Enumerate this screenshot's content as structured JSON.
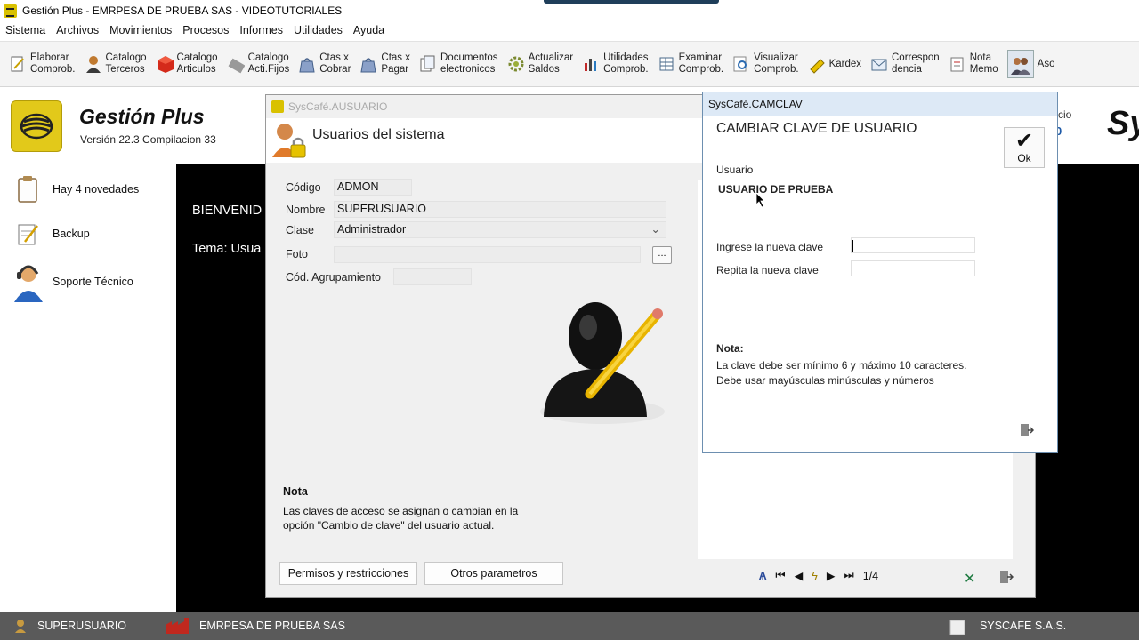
{
  "window": {
    "title": "Gestión Plus - EMRPESA DE PRUEBA SAS - VIDEOTUTORIALES"
  },
  "menu": [
    "Sistema",
    "Archivos",
    "Movimientos",
    "Procesos",
    "Informes",
    "Utilidades",
    "Ayuda"
  ],
  "toolbar": [
    {
      "l1": "Elaborar",
      "l2": "Comprob.",
      "icon": "pencil-doc-icon"
    },
    {
      "l1": "Catalogo",
      "l2": "Terceros",
      "icon": "person-icon"
    },
    {
      "l1": "Catalogo",
      "l2": "Articulos",
      "icon": "red-box-icon"
    },
    {
      "l1": "Catalogo",
      "l2": "Acti.Fijos",
      "icon": "tools-icon"
    },
    {
      "l1": "Ctas x",
      "l2": "Cobrar",
      "icon": "bag-icon"
    },
    {
      "l1": "Ctas x",
      "l2": "Pagar",
      "icon": "bag-icon"
    },
    {
      "l1": "Documentos",
      "l2": "electronicos",
      "icon": "docs-icon"
    },
    {
      "l1": "Actualizar",
      "l2": "Saldos",
      "icon": "gear-icon"
    },
    {
      "l1": "Utilidades",
      "l2": "Comprob.",
      "icon": "chart-icon"
    },
    {
      "l1": "Examinar",
      "l2": "Comprob.",
      "icon": "grid-icon"
    },
    {
      "l1": "Visualizar",
      "l2": "Comprob.",
      "icon": "magnifier-icon"
    },
    {
      "l1": "Kardex",
      "l2": "",
      "icon": "highlighter-icon"
    },
    {
      "l1": "Correspon",
      "l2": "dencia",
      "icon": "mail-icon"
    },
    {
      "l1": "Nota",
      "l2": "Memo",
      "icon": "note-icon"
    },
    {
      "l1": "Aso",
      "l2": "",
      "icon": "people-icon"
    }
  ],
  "brand": {
    "title": "Gestión Plus",
    "version": "Versión 22.3  Compilacion 33"
  },
  "sidebar": [
    {
      "label": "Hay 4 novedades",
      "icon": "clipboard-icon"
    },
    {
      "label": "Backup",
      "icon": "notepad-icon"
    },
    {
      "label": "Soporte Técnico",
      "icon": "headset-icon"
    }
  ],
  "main": {
    "welcome": "BIENVENID",
    "theme": "Tema: Usua"
  },
  "right_fragments": {
    "line1": "cio",
    "line2": "0",
    "logo": "Sy"
  },
  "status": {
    "user": "SUPERUSUARIO",
    "company": "EMRPESA DE PRUEBA SAS",
    "vendor": "SYSCAFE S.A.S."
  },
  "dialog_usuario": {
    "caption": "SysCafé.AUSUARIO",
    "header": "Usuarios del sistema",
    "fields": {
      "codigo_label": "Código",
      "codigo_value": "ADMON",
      "nombre_label": "Nombre",
      "nombre_value": "SUPERUSUARIO",
      "clase_label": "Clase",
      "clase_value": "Administrador",
      "foto_label": "Foto",
      "agrup_label": "Cód. Agrupamiento"
    },
    "dots": "...",
    "nota_title": "Nota",
    "nota_body": "Las claves de acceso se asignan o cambian en la opción \"Cambio de clave\" del usuario actual.",
    "btn_permisos": "Permisos y restricciones",
    "btn_otros": "Otros parametros",
    "pager": "1/4"
  },
  "dialog_clave": {
    "caption": "SysCafé.CAMCLAV",
    "header": "CAMBIAR CLAVE DE USUARIO",
    "ok_label": "Ok",
    "usuario_label": "Usuario",
    "usuario_value": "USUARIO DE PRUEBA",
    "nueva_label": "Ingrese la nueva clave",
    "repita_label": "Repita la nueva clave",
    "nota_title": "Nota:",
    "nota_line1": "La clave debe ser mínimo 6 y máximo 10 caracteres.",
    "nota_line2": "Debe usar mayúsculas minúsculas y números"
  }
}
